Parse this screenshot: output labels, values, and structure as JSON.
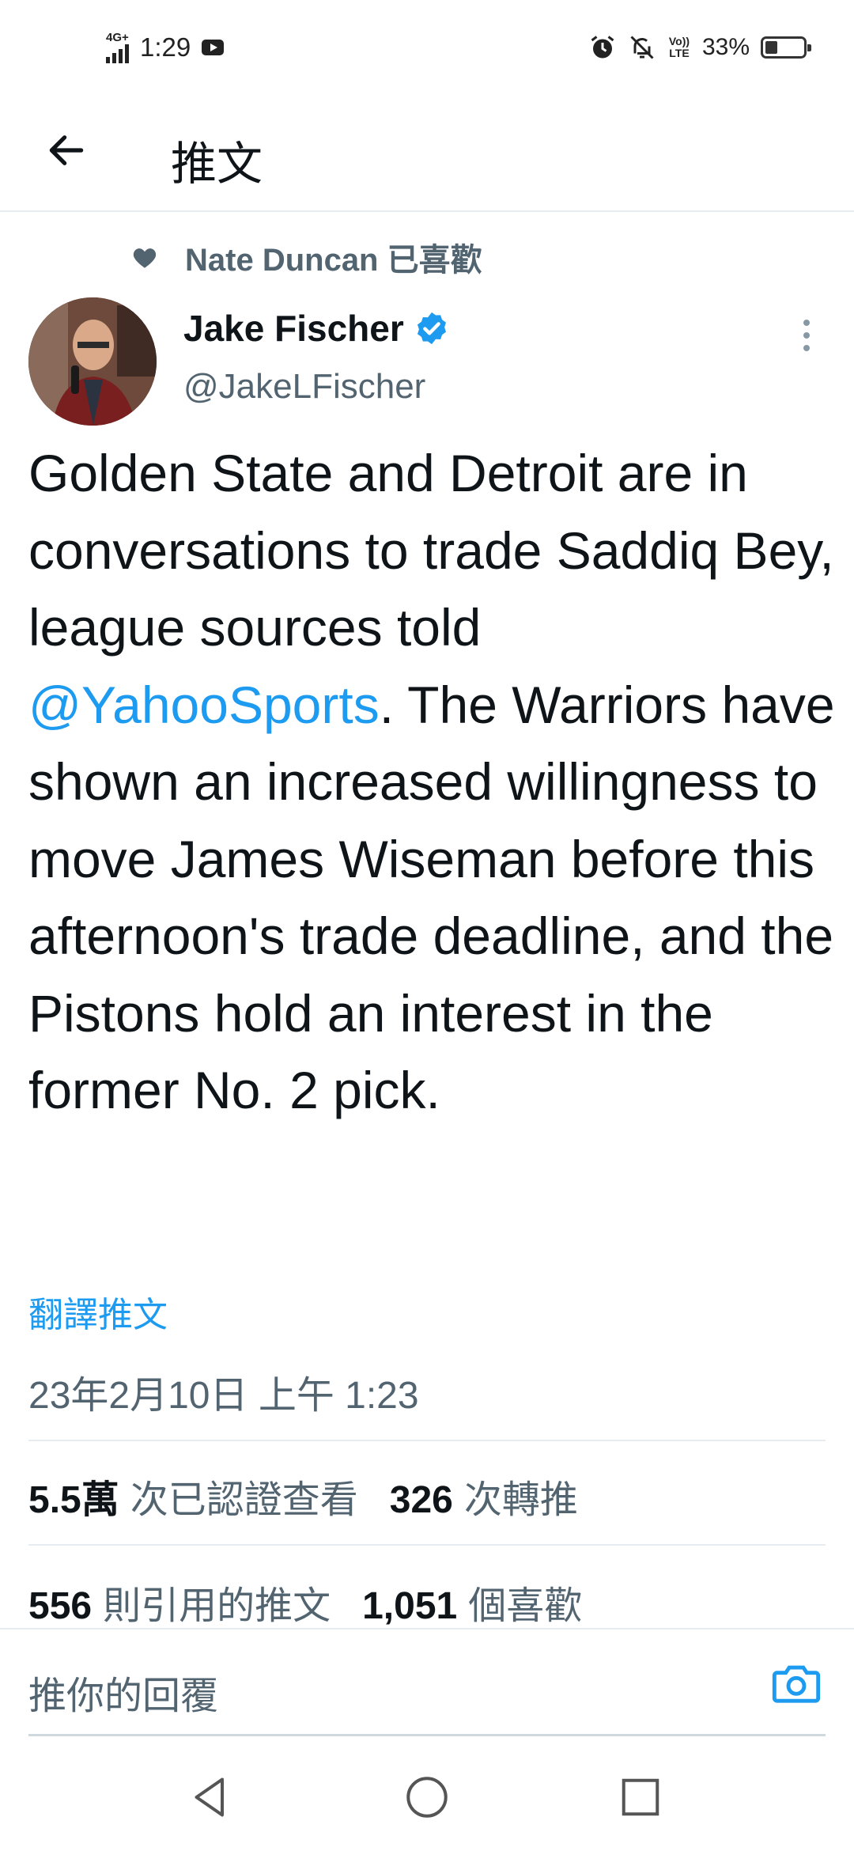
{
  "status_bar": {
    "network": "4G+",
    "time": "1:29",
    "volte": "Vo)) LTE",
    "battery_text": "33%",
    "battery_level": 0.33,
    "icons": [
      "signal-icon",
      "youtube-icon",
      "alarm-icon",
      "mute-bell-icon",
      "volte-icon",
      "battery-icon"
    ]
  },
  "header": {
    "back_icon": "back-arrow-icon",
    "title": "推文"
  },
  "tweet": {
    "liked_by": "Nate Duncan 已喜歡",
    "author": {
      "name": "Jake Fischer",
      "handle": "@JakeLFischer",
      "verified": true
    },
    "text_parts": {
      "before": "Golden State and Detroit are in conversations to trade Saddiq Bey, league sources told ",
      "mention": "@YahooSports",
      "after": ". The Warriors have shown an increased willingness to move James Wiseman before this afternoon's trade deadline, and the Pistons hold an interest in the former No. 2 pick."
    },
    "translate_label": "翻譯推文",
    "timestamp": "23年2月10日 上午 1:23",
    "stats": {
      "views_count": "5.5萬",
      "views_label": "次已認證查看",
      "retweets_count": "326",
      "retweets_label": "次轉推",
      "quotes_count": "556",
      "quotes_label": "則引用的推文",
      "likes_count": "1,051",
      "likes_label": "個喜歡"
    }
  },
  "reply": {
    "placeholder": "推你的回覆",
    "camera_icon": "camera-icon"
  },
  "nav_bar": {
    "buttons": [
      "back-triangle-icon",
      "home-circle-icon",
      "recents-square-icon"
    ]
  },
  "colors": {
    "accent": "#1d9bf0",
    "text_primary": "#0f1419",
    "text_secondary": "#536471",
    "divider": "#e6ecf0"
  }
}
